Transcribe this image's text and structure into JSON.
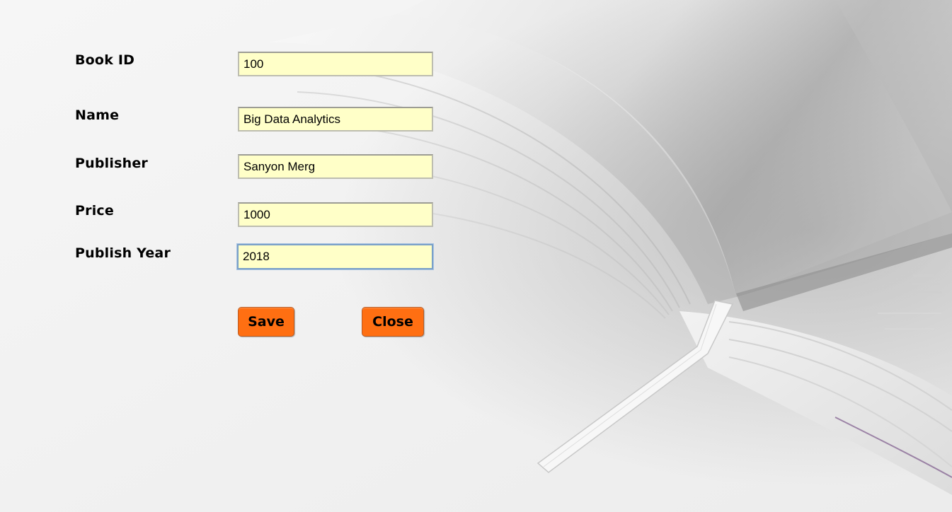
{
  "form": {
    "fields": [
      {
        "label": "Book ID",
        "value": "100"
      },
      {
        "label": "Name",
        "value": "Big Data Analytics"
      },
      {
        "label": "Publisher",
        "value": "Sanyon Merg"
      },
      {
        "label": "Price",
        "value": "1000"
      },
      {
        "label": "Publish Year",
        "value": "2018"
      }
    ],
    "focused_field": "Publish Year",
    "buttons": {
      "save_label": "Save",
      "close_label": "Close"
    }
  },
  "background": {
    "image": "open-book-photo",
    "accent": "#ff6f12",
    "field_bg": "#ffffc8"
  }
}
